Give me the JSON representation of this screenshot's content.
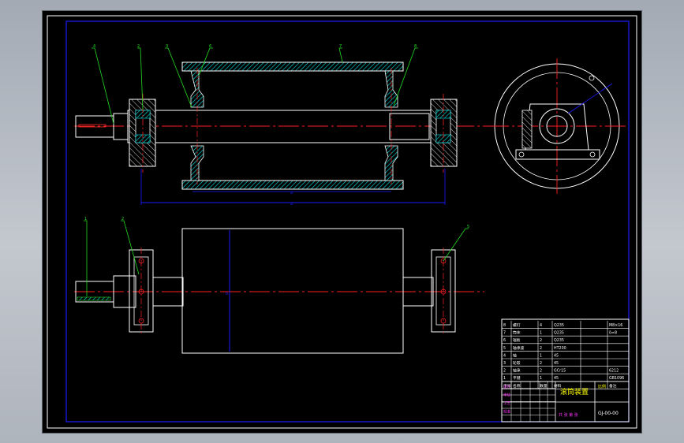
{
  "colors": {
    "background": "#000000",
    "frame": "#ffffff",
    "border": "#1a1aff",
    "centerline": "#ff2020",
    "hatch": "#00e6e6",
    "leader": "#22dd22",
    "title_text": "#ffff00",
    "magenta": "#ff33ff"
  },
  "balloons": {
    "front": [
      "4",
      "2",
      "3",
      "6",
      "7",
      "8"
    ],
    "plan": [
      "1",
      "2",
      "5"
    ]
  },
  "dimensions": {
    "length_inner": "a",
    "length_outer": "a",
    "width": "b"
  },
  "title_block": {
    "drawing_title": "滚筒装置",
    "drawing_number": "GJ-00-00",
    "parts": [
      {
        "no": "8",
        "name": "螺钉",
        "qty": "4",
        "material": "Q235",
        "note": "M8×16"
      },
      {
        "no": "7",
        "name": "筒体",
        "qty": "1",
        "material": "Q235",
        "note": "δ=8"
      },
      {
        "no": "6",
        "name": "辐板",
        "qty": "2",
        "material": "Q235",
        "note": ""
      },
      {
        "no": "5",
        "name": "轴承座",
        "qty": "2",
        "material": "HT200",
        "note": ""
      },
      {
        "no": "4",
        "name": "轴",
        "qty": "1",
        "material": "45",
        "note": ""
      },
      {
        "no": "3",
        "name": "轮毂",
        "qty": "2",
        "material": "45",
        "note": ""
      },
      {
        "no": "2",
        "name": "轴承",
        "qty": "2",
        "material": "GCr15",
        "note": "6212"
      },
      {
        "no": "1",
        "name": "平键",
        "qty": "1",
        "material": "45",
        "note": "GB1096"
      }
    ],
    "header": {
      "no": "序号",
      "name": "名称",
      "qty": "数量",
      "material": "材料",
      "note": "备注"
    },
    "sign_rows": [
      "设计",
      "审核",
      "工艺",
      "批准"
    ],
    "scale_label": "比例",
    "sheet_label": "共 张 第 张"
  }
}
